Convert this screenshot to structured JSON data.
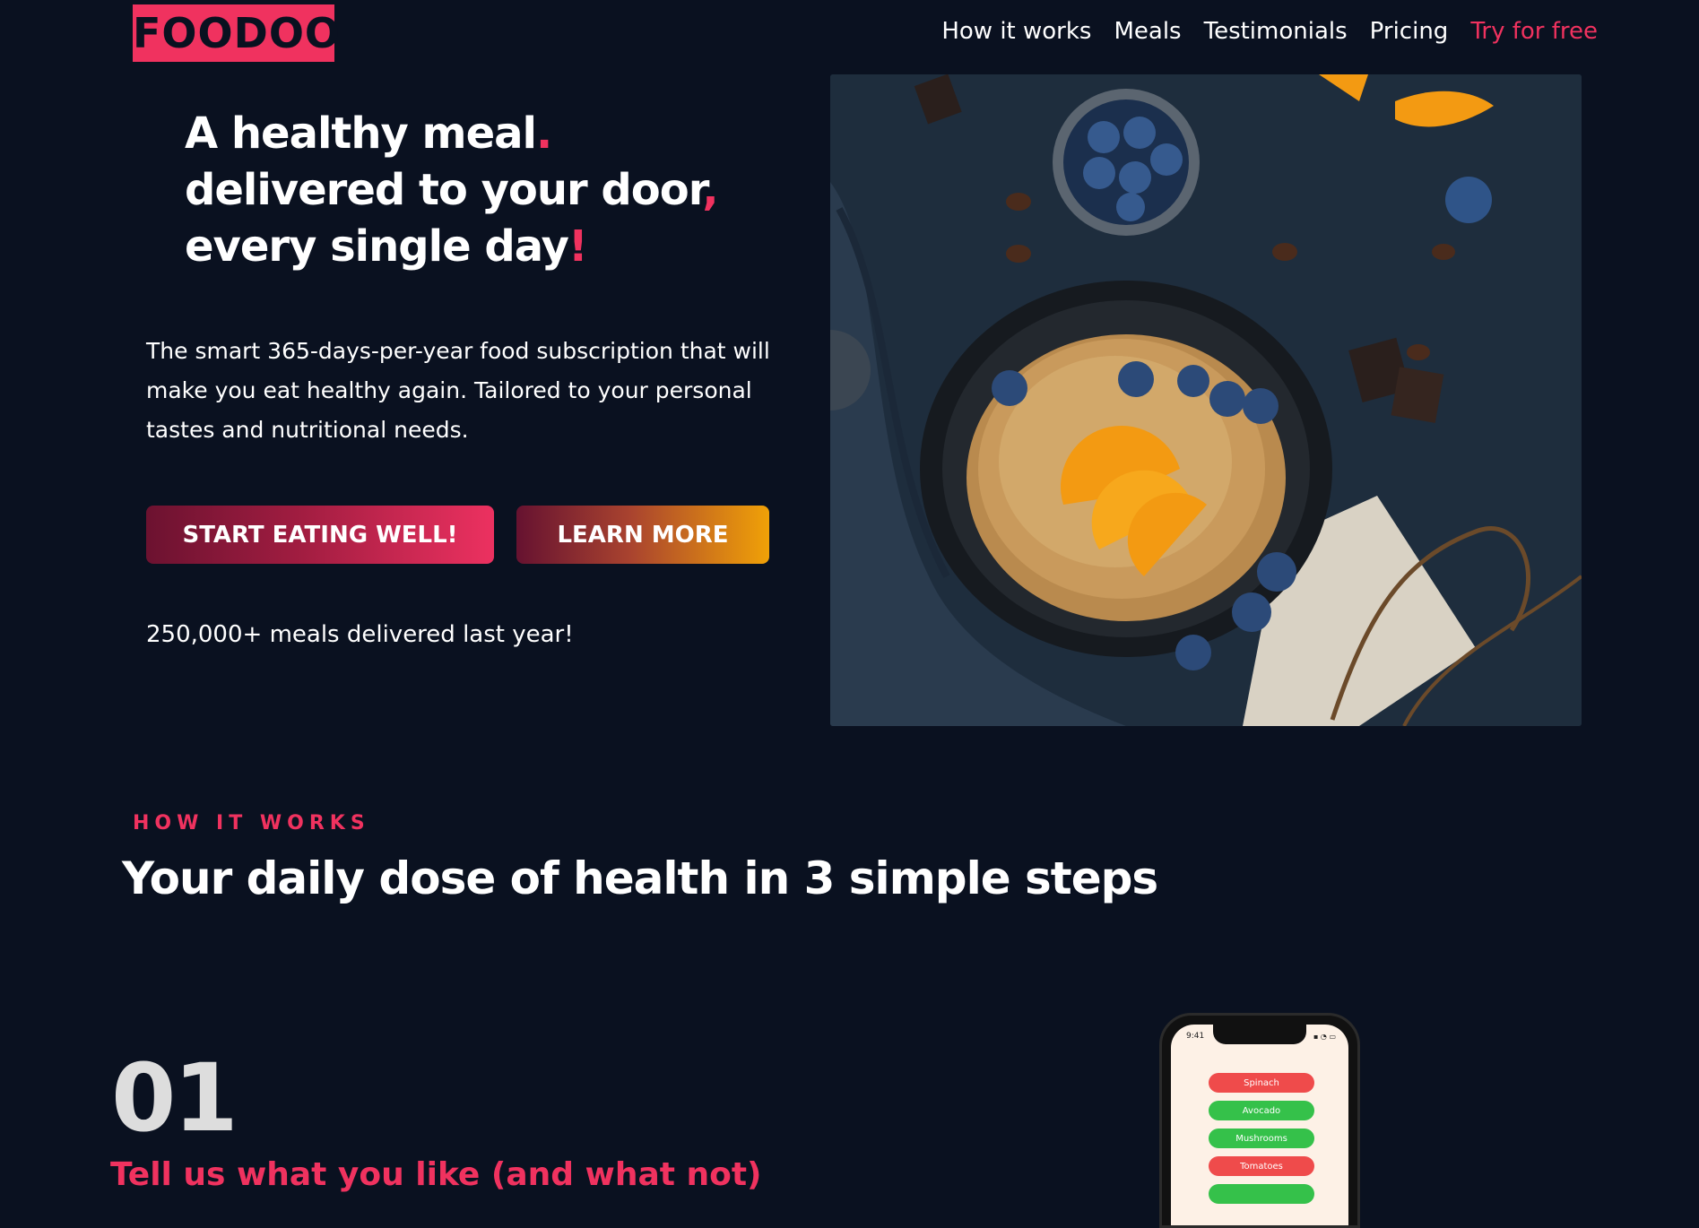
{
  "brand": {
    "logo_text": "FOODOO"
  },
  "nav": {
    "items": [
      {
        "label": "How it works"
      },
      {
        "label": "Meals"
      },
      {
        "label": "Testimonials"
      },
      {
        "label": "Pricing"
      }
    ],
    "cta_label": "Try for free"
  },
  "hero": {
    "title_line1": "A healthy meal",
    "title_line1_punct": ".",
    "title_line2": "delivered to your door",
    "title_line2_punct": ",",
    "title_line3": "every single day",
    "title_line3_punct": "!",
    "description": "The smart 365-days-per-year food subscription that will make you eat healthy again. Tailored to your personal tastes and nutritional needs.",
    "primary_button": "START EATING WELL!",
    "secondary_button": "LEARN MORE",
    "stat": "250,000+ meals delivered last year!"
  },
  "how_it_works": {
    "eyebrow": "HOW IT WORKS",
    "title": "Your daily dose of health in 3 simple steps",
    "step_number": "01",
    "step_title": "Tell us what you like (and what not)"
  },
  "phone": {
    "time": "9:41",
    "foods": [
      {
        "label": "Spinach",
        "color": "#ef4b4b"
      },
      {
        "label": "Avocado",
        "color": "#35c14a"
      },
      {
        "label": "Mushrooms",
        "color": "#35c14a"
      },
      {
        "label": "Tomatoes",
        "color": "#ef4b4b"
      },
      {
        "label": "",
        "color": "#35c14a"
      }
    ]
  },
  "colors": {
    "background": "#0a1120",
    "accent": "#f0325f",
    "gold": "#f0a107"
  }
}
